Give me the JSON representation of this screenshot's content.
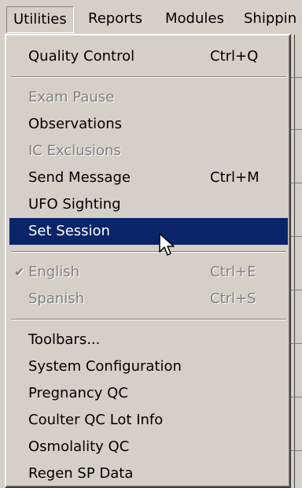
{
  "menubar": {
    "items": [
      {
        "label": "Utilities"
      },
      {
        "label": "Reports"
      },
      {
        "label": "Modules"
      },
      {
        "label": "Shippin"
      }
    ]
  },
  "menu": {
    "items": [
      {
        "label": "Quality Control",
        "shortcut": "Ctrl+Q"
      },
      {
        "label": "Exam Pause"
      },
      {
        "label": "Observations"
      },
      {
        "label": "IC Exclusions"
      },
      {
        "label": "Send Message",
        "shortcut": "Ctrl+M"
      },
      {
        "label": "UFO Sighting"
      },
      {
        "label": "Set Session"
      },
      {
        "label": "English",
        "shortcut": "Ctrl+E",
        "checked": true
      },
      {
        "label": "Spanish",
        "shortcut": "Ctrl+S"
      },
      {
        "label": "Toolbars..."
      },
      {
        "label": "System Configuration"
      },
      {
        "label": "Pregnancy QC"
      },
      {
        "label": "Coulter QC Lot Info"
      },
      {
        "label": "Osmolality QC"
      },
      {
        "label": "Regen SP Data"
      }
    ]
  },
  "colors": {
    "menu_face": "#d4d0c8",
    "highlight": "#0a246a",
    "disabled_text": "#808080"
  }
}
